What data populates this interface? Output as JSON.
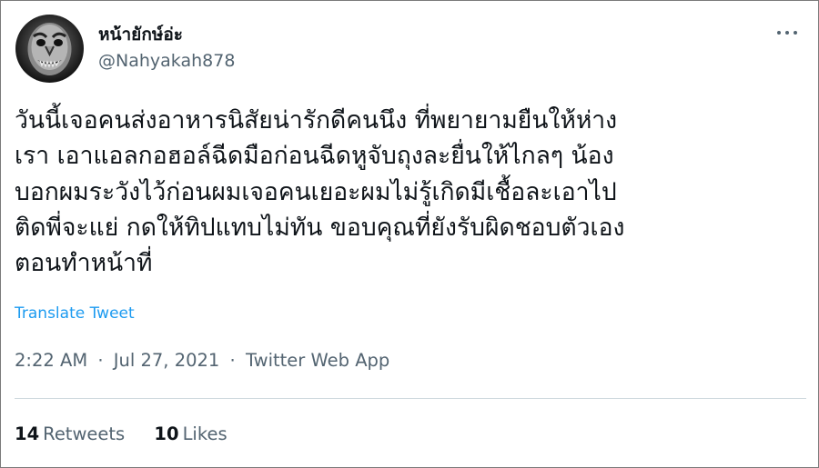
{
  "author": {
    "display_name": "หน้ายักษ์อ่ะ",
    "handle": "@Nahyakah878"
  },
  "tweet": {
    "text_lines": [
      "วันนี้เจอคนส่งอาหารนิสัยน่ารักดีคนนึง ที่พยายามยืนให้ห่าง",
      "เรา เอาแอลกอฮอล์ฉีดมือก่อนฉีดหูจับถุงละยื่นให้ไกลๆ น้อง",
      "บอกผมระวังไว้ก่อนผมเจอคนเยอะผมไม่รู้เกิดมีเชื้อละเอาไป",
      "ติดพี่จะแย่ กดให้ทิปแทบไม่ทัน ขอบคุณที่ยังรับผิดชอบตัวเอง",
      "ตอนทำหน้าที่"
    ],
    "translate_label": "Translate Tweet",
    "time": "2:22 AM",
    "separator": "·",
    "date": "Jul 27, 2021",
    "source": "Twitter Web App"
  },
  "stats": {
    "retweets_count": "14",
    "retweets_label": "Retweets",
    "likes_count": "10",
    "likes_label": "Likes"
  },
  "icons": {
    "more": "more-horizontal-icon"
  },
  "colors": {
    "link": "#1d9bf0",
    "secondary_text": "#536471",
    "primary_text": "#0f1419",
    "divider": "#cfd9de"
  }
}
